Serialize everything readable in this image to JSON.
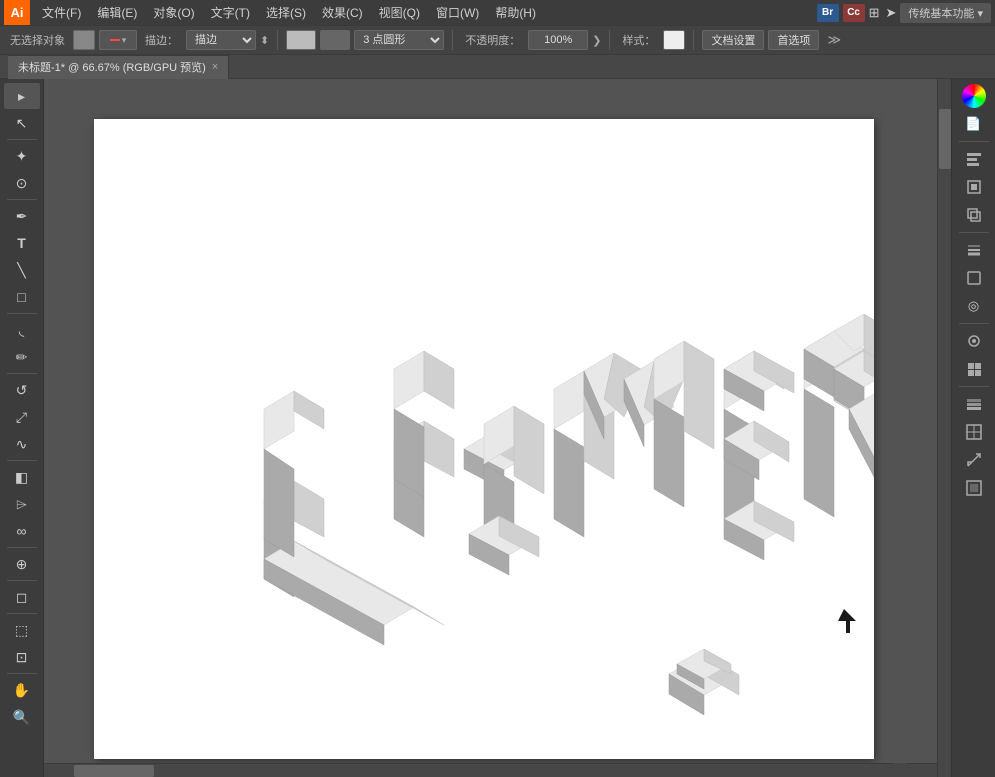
{
  "app": {
    "logo": "Ai",
    "logo_bg": "#ff6600"
  },
  "menu": {
    "items": [
      "文件(F)",
      "编辑(E)",
      "对象(O)",
      "文字(T)",
      "选择(S)",
      "效果(C)",
      "视图(Q)",
      "窗口(W)",
      "帮助(H)"
    ],
    "right": {
      "br_badge": "Br",
      "cc_badge": "Cc",
      "tradition_label": "传统基本功能 ▾"
    }
  },
  "toolbar": {
    "no_select_label": "无选择对象",
    "stroke_label": "描边：",
    "point_shape_label": "3 点圆形",
    "opacity_label": "不透明度：",
    "opacity_value": "100%",
    "style_label": "样式：",
    "doc_settings_label": "文档设置",
    "preferences_label": "首选项"
  },
  "tab": {
    "title": "未标题-1* @ 66.67% (RGB/GPU 预览)",
    "close": "×"
  },
  "tools_left": [
    {
      "name": "selection-tool",
      "icon": "▸",
      "label": "选择工具"
    },
    {
      "name": "direct-select-tool",
      "icon": "↖",
      "label": "直接选择"
    },
    {
      "name": "magic-wand-tool",
      "icon": "✦",
      "label": "魔术棒"
    },
    {
      "name": "lasso-tool",
      "icon": "⊙",
      "label": "套索"
    },
    {
      "name": "pen-tool",
      "icon": "✒",
      "label": "钢笔"
    },
    {
      "name": "type-tool",
      "icon": "T",
      "label": "文字"
    },
    {
      "name": "line-tool",
      "icon": "\\",
      "label": "直线"
    },
    {
      "name": "rect-tool",
      "icon": "□",
      "label": "矩形"
    },
    {
      "name": "brush-tool",
      "icon": "◟",
      "label": "画笔"
    },
    {
      "name": "pencil-tool",
      "icon": "✏",
      "label": "铅笔"
    },
    {
      "name": "rotate-tool",
      "icon": "↺",
      "label": "旋转"
    },
    {
      "name": "scale-tool",
      "icon": "⤢",
      "label": "缩放"
    },
    {
      "name": "warp-tool",
      "icon": "⟆",
      "label": "变形"
    },
    {
      "name": "gradient-tool",
      "icon": "◧",
      "label": "渐变"
    },
    {
      "name": "eyedropper-tool",
      "icon": "⊘",
      "label": "吸管"
    },
    {
      "name": "blend-tool",
      "icon": "∞",
      "label": "混合"
    },
    {
      "name": "slice-tool",
      "icon": "⊕",
      "label": "切片"
    },
    {
      "name": "eraser-tool",
      "icon": "◻",
      "label": "橡皮擦"
    },
    {
      "name": "chart-tool",
      "icon": "⬚",
      "label": "图表"
    },
    {
      "name": "hand-tool",
      "icon": "✋",
      "label": "抓手"
    },
    {
      "name": "zoom-tool",
      "icon": "⊕",
      "label": "缩放"
    }
  ],
  "artwork": {
    "text": "UIMEIR",
    "description": "3D isometric extruded text",
    "colors": {
      "top": "#e8e8e8",
      "left": "#b0b0b0",
      "right": "#d0d0d0"
    }
  },
  "right_panel": {
    "icons": [
      "🎨",
      "📄",
      "⊞",
      "✕",
      "⊕",
      "≡",
      "□",
      "◎",
      "⊛",
      "⊕",
      "◧",
      "↕"
    ]
  }
}
